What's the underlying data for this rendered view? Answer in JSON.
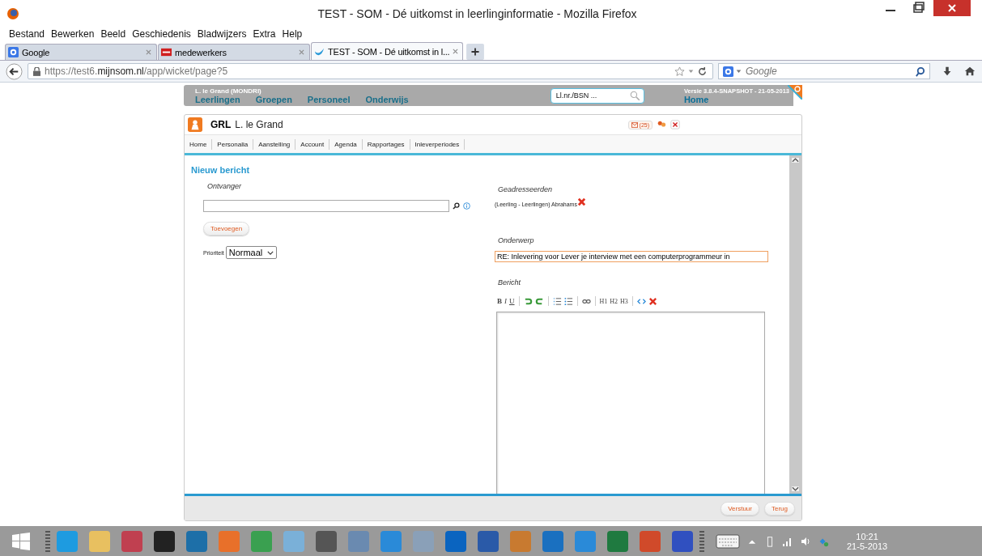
{
  "window": {
    "title": "TEST - SOM - Dé uitkomst in leerlinginformatie - Mozilla Firefox"
  },
  "menu": [
    "Bestand",
    "Bewerken",
    "Beeld",
    "Geschiedenis",
    "Bladwijzers",
    "Extra",
    "Help"
  ],
  "tabs": [
    {
      "label": "Google",
      "selected": false,
      "kind": "google"
    },
    {
      "label": "medewerkers",
      "selected": false,
      "kind": "red"
    },
    {
      "label": "TEST - SOM - Dé uitkomst in l...",
      "selected": true,
      "kind": "bird"
    }
  ],
  "url": {
    "prefix": "https://test6.",
    "domain": "mijnsom.nl",
    "path": "/app/wicket/page?5"
  },
  "search": {
    "placeholder": "Google"
  },
  "app": {
    "user": "L. le Grand (MONDRI)",
    "nav": [
      "Leerlingen",
      "Groepen",
      "Personeel",
      "Onderwijs"
    ],
    "search_placeholder": "Ll.nr./BSN ...",
    "version": "Versie 3.8.4-SNAPSHOT - 21-05-2013",
    "home": "Home"
  },
  "person": {
    "code": "GRL",
    "name": "L. le Grand",
    "mail_count": "(25)"
  },
  "subnav": [
    "Home",
    "Personalia",
    "Aanstelling",
    "Account",
    "Agenda",
    "Rapportages",
    "Inleverperiodes"
  ],
  "form": {
    "heading": "Nieuw bericht",
    "recipient_label": "Ontvanger",
    "add_button": "Toevoegen",
    "priority_label": "Prioriteit",
    "priority": "Normaal",
    "addressees_label": "Geadresseerden",
    "addressees": [
      "(Leerling - Leerlingen) Abrahams"
    ],
    "subject_label": "Onderwerp",
    "subject": "RE: Inlevering voor Lever je interview met een computerprogrammeur in",
    "message_label": "Bericht",
    "tool_groups": [
      [
        {
          "kind": "bold",
          "label": "B"
        },
        {
          "kind": "italic",
          "label": "I"
        },
        {
          "kind": "underline",
          "label": "U"
        }
      ],
      [
        {
          "kind": "undo"
        },
        {
          "kind": "redo"
        }
      ],
      [
        {
          "kind": "ordered-list"
        },
        {
          "kind": "bullet-list"
        }
      ],
      [
        {
          "kind": "link"
        }
      ],
      [
        {
          "kind": "heading",
          "label": "H1"
        },
        {
          "kind": "heading",
          "label": "H2"
        },
        {
          "kind": "heading",
          "label": "H3"
        }
      ],
      [
        {
          "kind": "source"
        },
        {
          "kind": "clear"
        }
      ]
    ]
  },
  "footer_buttons": [
    "Verstuur",
    "Terug"
  ],
  "taskbar": {
    "apps": [
      {
        "color": "#1e9be0"
      },
      {
        "color": "#e8c060"
      },
      {
        "color": "#c04050"
      },
      {
        "color": "#222222"
      },
      {
        "color": "#1d6fa8"
      },
      {
        "color": "#e8702a"
      },
      {
        "color": "#3aa050"
      },
      {
        "color": "#7ab0d8"
      },
      {
        "color": "#555555"
      },
      {
        "color": "#6a8ab0"
      },
      {
        "color": "#2a8ad8"
      },
      {
        "color": "#8aa0b8"
      },
      {
        "color": "#0a64c0"
      },
      {
        "color": "#2a5aa8"
      },
      {
        "color": "#c87a30"
      },
      {
        "color": "#1a70c0"
      },
      {
        "color": "#2a8ad8"
      },
      {
        "color": "#1f7a40"
      },
      {
        "color": "#d04a2a"
      },
      {
        "color": "#3050c0"
      }
    ],
    "time": "10:21",
    "date": "21-5-2013"
  }
}
